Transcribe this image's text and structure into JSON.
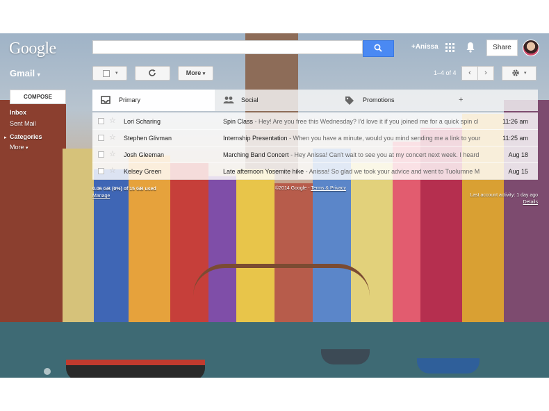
{
  "header": {
    "logo": "Google",
    "search": {
      "placeholder": "",
      "value": ""
    },
    "user_name": "+Anissa",
    "share_label": "Share"
  },
  "gmail_label": "Gmail",
  "toolbar": {
    "more_label": "More",
    "page_count": "1–4 of 4"
  },
  "sidebar": {
    "compose_label": "COMPOSE",
    "items": [
      {
        "label": "Inbox"
      },
      {
        "label": "Sent Mail"
      },
      {
        "label": "Categories"
      },
      {
        "label": "More"
      }
    ]
  },
  "tabs": [
    {
      "label": "Primary",
      "icon": "inbox-icon",
      "active": true
    },
    {
      "label": "Social",
      "icon": "people-icon",
      "active": false
    },
    {
      "label": "Promotions",
      "icon": "tag-icon",
      "active": false
    }
  ],
  "emails": [
    {
      "sender": "Lori Scharing",
      "subject": "Spin Class",
      "snippet": " - Hey! Are you free this Wednesday? I'd love it if you joined me for a quick spin cl",
      "date": "11:26 am"
    },
    {
      "sender": "Stephen Glivman",
      "subject": "Internship Presentation",
      "snippet": " - When you have a minute, would you mind sending me a link to your",
      "date": "11:25 am"
    },
    {
      "sender": "Josh Gleeman",
      "subject": "Marching Band Concert",
      "snippet": " - Hey Anissa! Can't wait to see you at my concert next week. I heard",
      "date": "Aug 18"
    },
    {
      "sender": "Kelsey Green",
      "subject": "Late afternoon Yosemite hike",
      "snippet": " - Anissa! So glad we took your advice and went to Tuolumne M",
      "date": "Aug 15"
    }
  ],
  "footer": {
    "storage": "0.06 GB (0%) of 15 GB used",
    "manage": "Manage",
    "copyright": "©2014 Google - ",
    "terms": "Terms & Privacy",
    "activity": "Last account activity: 1 day ago",
    "details": "Details"
  },
  "colors": {
    "search_button": "#4a89f3",
    "accent": "#4a89f3"
  }
}
